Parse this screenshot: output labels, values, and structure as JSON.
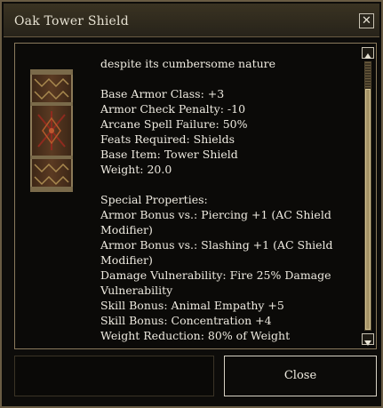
{
  "window": {
    "title": "Oak Tower Shield",
    "close_icon_glyph": "✕"
  },
  "item": {
    "icon": "tower-shield-icon",
    "lines": [
      "despite its cumbersome nature",
      "",
      "Base Armor Class: +3",
      "Armor Check Penalty: -10",
      "Arcane Spell Failure: 50%",
      "Feats Required: Shields",
      "Base Item: Tower Shield",
      "Weight: 20.0",
      "",
      "Special Properties:",
      "Armor Bonus vs.: Piercing +1 (AC Shield Modifier)",
      "Armor Bonus vs.: Slashing +1 (AC Shield Modifier)",
      "Damage Vulnerability: Fire 25% Damage Vulnerability",
      "Skill Bonus: Animal Empathy +5",
      "Skill Bonus: Concentration +4",
      "Weight Reduction: 80% of Weight"
    ]
  },
  "scrollbar": {
    "position_fraction": 1.0,
    "visible_fraction": 0.9
  },
  "buttons": {
    "close_label": "Close"
  },
  "colors": {
    "text": "#eeeae0",
    "border": "#8a7a5c",
    "titlebar": "#2f2a1e"
  }
}
